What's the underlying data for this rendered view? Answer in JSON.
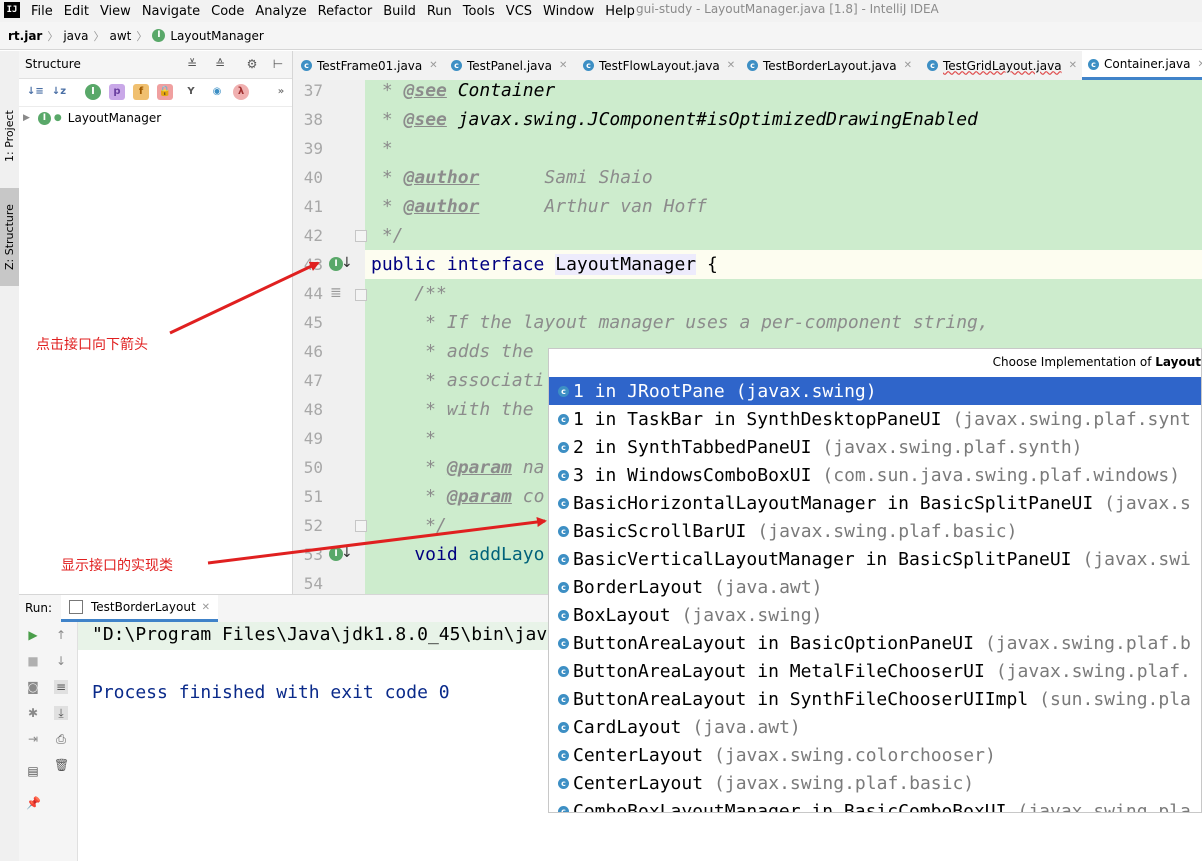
{
  "menubar": {
    "items": [
      "File",
      "Edit",
      "View",
      "Navigate",
      "Code",
      "Analyze",
      "Refactor",
      "Build",
      "Run",
      "Tools",
      "VCS",
      "Window",
      "Help"
    ],
    "window_title": "gui-study - LayoutManager.java [1.8] - IntelliJ IDEA"
  },
  "navbar": {
    "crumbs": [
      "rt.jar",
      "java",
      "awt",
      "LayoutManager"
    ]
  },
  "left_stripe": {
    "project_tab": "1: Project",
    "structure_tab": "Z: Structure"
  },
  "structure": {
    "title": "Structure",
    "tree_item": "LayoutManager"
  },
  "tabs": [
    {
      "label": "TestFrame01.java"
    },
    {
      "label": "TestPanel.java"
    },
    {
      "label": "TestFlowLayout.java"
    },
    {
      "label": "TestBorderLayout.java"
    },
    {
      "label": "TestGridLayout.java"
    },
    {
      "label": "Container.java"
    }
  ],
  "editor": {
    "line_numbers": [
      "37",
      "38",
      "39",
      "40",
      "41",
      "42",
      "43",
      "44",
      "45",
      "46",
      "47",
      "48",
      "49",
      "50",
      "51",
      "52",
      "53",
      "54"
    ],
    "l37": {
      "prefix": " * ",
      "tag": "@see",
      "text": " Container"
    },
    "l38": {
      "prefix": " * ",
      "tag": "@see",
      "text": " javax.swing.JComponent#isOptimizedDrawingEnabled"
    },
    "l39": " *",
    "l40": {
      "prefix": " * ",
      "tag": "@author",
      "text": "      Sami Shaio"
    },
    "l41": {
      "prefix": " * ",
      "tag": "@author",
      "text": "      Arthur van Hoff"
    },
    "l42": " */",
    "l43": {
      "kw": "public interface ",
      "name": "LayoutManager",
      " brace": " {",
      "brace": " {"
    },
    "l44": "    /**",
    "l45": "     * If the layout manager uses a per-component string,",
    "l46": "     * adds the",
    "l47": "     * associati",
    "l48": "     * with the",
    "l49": "     *",
    "l50": {
      "prefix": "     * ",
      "tag": "@param",
      "text": " na"
    },
    "l51": {
      "prefix": "     * ",
      "tag": "@param",
      "text": " co"
    },
    "l52": "     */",
    "l53": {
      "kw": "    void ",
      "text": "addLayo"
    }
  },
  "run": {
    "label": "Run:",
    "tab": "TestBorderLayout",
    "cmd_line": "\"D:\\Program Files\\Java\\jdk1.8.0_45\\bin\\jav",
    "exit_line": "Process finished with exit code 0"
  },
  "popup": {
    "title_prefix": "Choose Implementation of ",
    "title_bold": "Layout",
    "items": [
      {
        "name": "1 in JRootPane",
        "pkg": "(javax.swing)"
      },
      {
        "name": "1 in TaskBar in SynthDesktopPaneUI",
        "pkg": "(javax.swing.plaf.synt"
      },
      {
        "name": "2 in SynthTabbedPaneUI",
        "pkg": "(javax.swing.plaf.synth)"
      },
      {
        "name": "3 in WindowsComboBoxUI",
        "pkg": "(com.sun.java.swing.plaf.windows)"
      },
      {
        "name": "BasicHorizontalLayoutManager in BasicSplitPaneUI",
        "pkg": "(javax.s"
      },
      {
        "name": "BasicScrollBarUI",
        "pkg": "(javax.swing.plaf.basic)"
      },
      {
        "name": "BasicVerticalLayoutManager in BasicSplitPaneUI",
        "pkg": "(javax.swi"
      },
      {
        "name": "BorderLayout",
        "pkg": "(java.awt)"
      },
      {
        "name": "BoxLayout",
        "pkg": "(javax.swing)"
      },
      {
        "name": "ButtonAreaLayout in BasicOptionPaneUI",
        "pkg": "(javax.swing.plaf.b"
      },
      {
        "name": "ButtonAreaLayout in MetalFileChooserUI",
        "pkg": "(javax.swing.plaf."
      },
      {
        "name": "ButtonAreaLayout in SynthFileChooserUIImpl",
        "pkg": "(sun.swing.pla"
      },
      {
        "name": "CardLayout",
        "pkg": "(java.awt)"
      },
      {
        "name": "CenterLayout",
        "pkg": "(javax.swing.colorchooser)"
      },
      {
        "name": "CenterLayout",
        "pkg": "(javax.swing.plaf.basic)"
      },
      {
        "name": "ComboBoxLayoutManager in BasicComboBoxUI",
        "pkg": "(javax.swing.pla"
      }
    ]
  },
  "annotations": {
    "click_arrow": "点击接口向下箭头",
    "show_impl": "显示接口的实现类"
  },
  "colors": {
    "accent": "#2f65ca",
    "doc_bg": "#cdeccd",
    "annotation": "#e02020"
  }
}
